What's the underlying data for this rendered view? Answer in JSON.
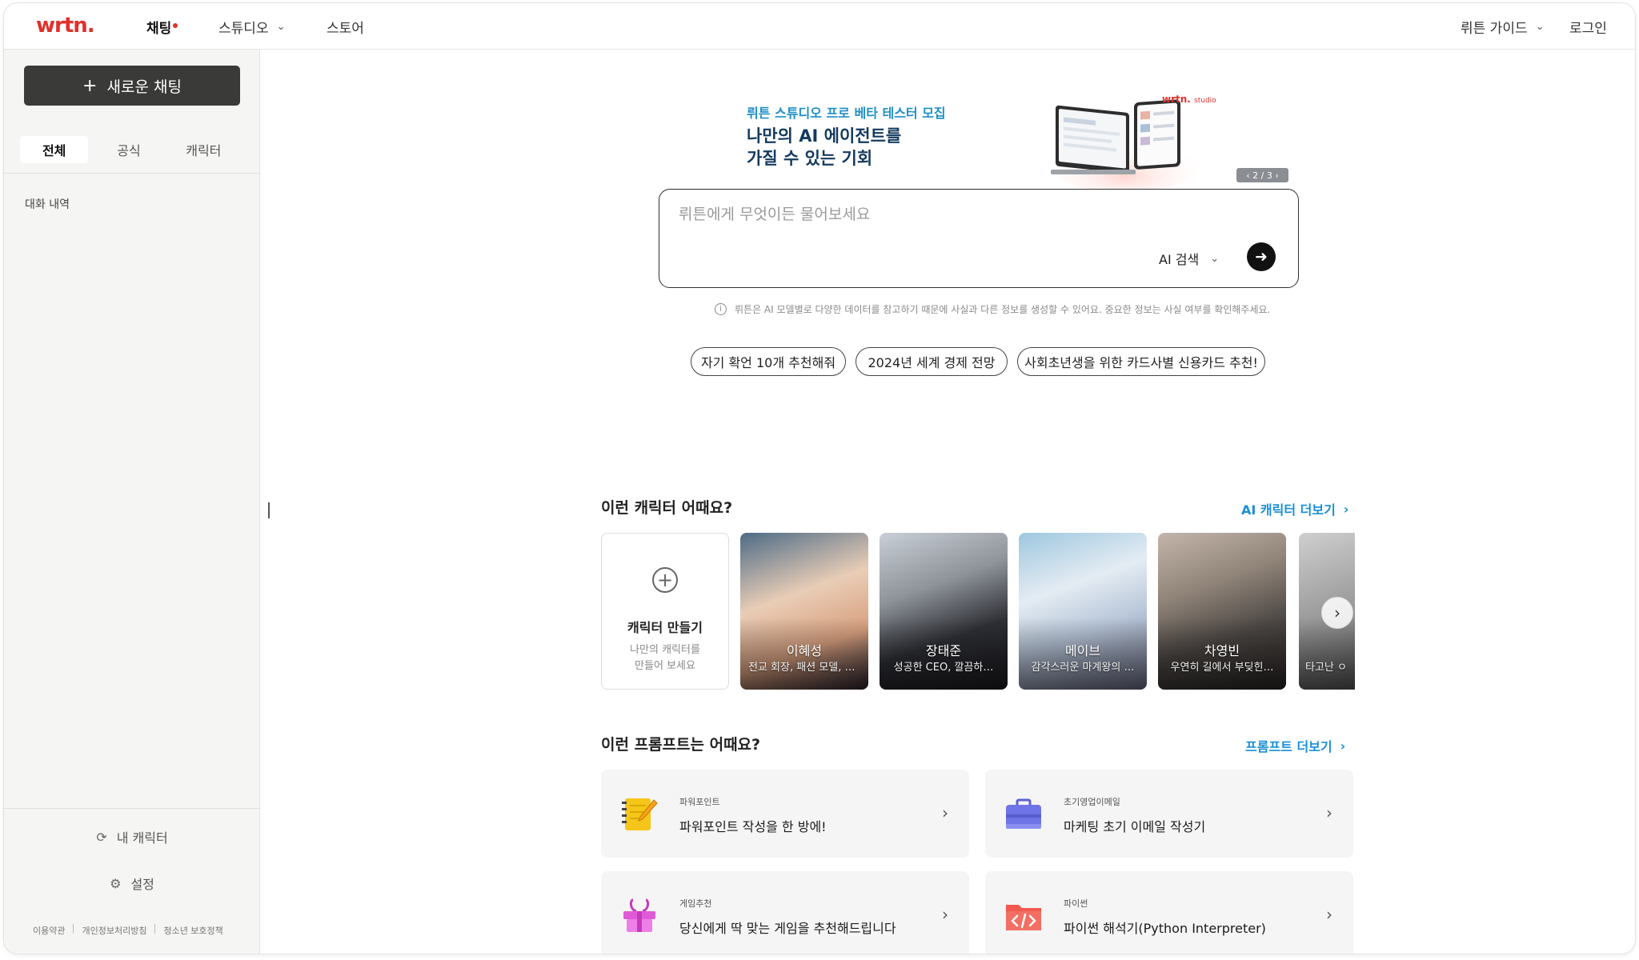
{
  "header": {
    "logo": "wrtn.",
    "nav": {
      "chat": "채팅",
      "studio": "스튜디오",
      "store": "스토어",
      "guide": "뤼튼 가이드",
      "login": "로그인"
    }
  },
  "sidebar": {
    "new_chat": "새로운 채팅",
    "tabs": [
      "전체",
      "공식",
      "캐릭터"
    ],
    "history_title": "대화 내역",
    "my_character": "내 캐릭터",
    "settings": "설정",
    "footer": [
      "이용약관",
      "개인정보처리방침",
      "청소년 보호정책"
    ]
  },
  "banner": {
    "subtitle": "뤼튼 스튜디오 프로 베타 테스터 모집",
    "title_line1": "나만의 AI 에이전트를",
    "title_line2": "가질 수 있는 기회",
    "studio_logo": "wrtn.",
    "studio_logo_suffix": "studio",
    "pager": "‹ 2 / 3 ›"
  },
  "search": {
    "placeholder": "뤼튼에게 무엇이든 물어보세요",
    "mode": "AI 검색",
    "disclaimer": "뤼튼은 AI 모델별로 다양한 데이터를 참고하기 때문에 사실과 다른 정보를 생성할 수 있어요. 중요한 정보는 사실 여부를 확인해주세요."
  },
  "suggestions": [
    "자기 확언 10개 추천해줘",
    "2024년 세계 경제 전망",
    "사회초년생을 위한 카드사별 신용카드 추천!"
  ],
  "characters": {
    "title": "이런 캐릭터 어때요?",
    "more": "AI 캐릭터 더보기",
    "make": {
      "title": "캐릭터 만들기",
      "desc_line1": "나만의 캐릭터를",
      "desc_line2": "만들어 보세요"
    },
    "items": [
      {
        "name": "이혜성",
        "desc": "전교 회장, 패션 모델, 어…",
        "color1": "#c9a48f",
        "color2": "#3a2f3a"
      },
      {
        "name": "장태준",
        "desc": "성공한 CEO, 깔끔하…",
        "color1": "#9a9fa6",
        "color2": "#2a2a2e"
      },
      {
        "name": "메이브",
        "desc": "감각스러운 마계왕의 …",
        "color1": "#cfd8e4",
        "color2": "#5d6f8c"
      },
      {
        "name": "차영빈",
        "desc": "우연히 길에서 부딪힌…",
        "color1": "#b8b2aa",
        "color2": "#3b3733"
      }
    ],
    "partial_desc": "타고난 ㅇ"
  },
  "prompts": {
    "title": "이런 프롬프트는 어때요?",
    "more": "프롬프트 더보기",
    "items": [
      {
        "category": "파워포인트",
        "title": "파워포인트 작성을 한 방에!",
        "icon": "notepad-icon"
      },
      {
        "category": "초기영업이메일",
        "title": "마케팅 초기 이메일 작성기",
        "icon": "briefcase-icon"
      },
      {
        "category": "게임추천",
        "title": "당신에게 딱 맞는 게임을 추천해드립니다",
        "icon": "gift-box-icon"
      },
      {
        "category": "파이썬",
        "title": "파이썬 해석기(Python Interpreter)",
        "icon": "code-folder-icon"
      }
    ]
  }
}
